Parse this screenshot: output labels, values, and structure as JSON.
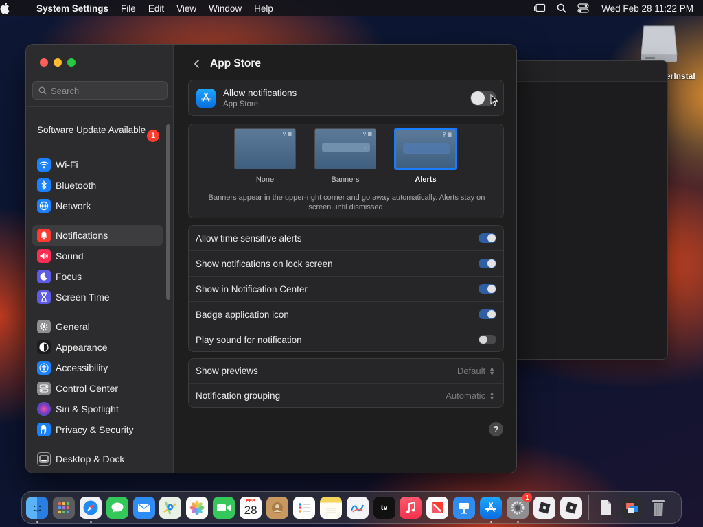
{
  "menubar": {
    "app_name": "System Settings",
    "menus": [
      "File",
      "Edit",
      "View",
      "Window",
      "Help"
    ],
    "clock": "Wed Feb 28  11:22 PM"
  },
  "desktop": {
    "drive_label": "erInstal"
  },
  "sidebar": {
    "search_placeholder": "Search",
    "software_update": {
      "label": "Software Update Available",
      "badge": "1"
    },
    "items": [
      {
        "label": "Wi-Fi",
        "icon": "wifi-icon",
        "color": "#1a82ff"
      },
      {
        "label": "Bluetooth",
        "icon": "bluetooth-icon",
        "color": "#1a82ff"
      },
      {
        "label": "Network",
        "icon": "globe-icon",
        "color": "#1a82ff"
      },
      {
        "label": "Notifications",
        "icon": "bell-icon",
        "color": "#ff3b30"
      },
      {
        "label": "Sound",
        "icon": "speaker-icon",
        "color": "#ff2d55"
      },
      {
        "label": "Focus",
        "icon": "moon-icon",
        "color": "#5e5ce6"
      },
      {
        "label": "Screen Time",
        "icon": "hourglass-icon",
        "color": "#5e5ce6"
      },
      {
        "label": "General",
        "icon": "gear-icon",
        "color": "#8e8e93"
      },
      {
        "label": "Appearance",
        "icon": "appearance-icon",
        "color": "#1c1c1e"
      },
      {
        "label": "Accessibility",
        "icon": "accessibility-icon",
        "color": "#1a82ff"
      },
      {
        "label": "Control Center",
        "icon": "control-center-icon",
        "color": "#8e8e93"
      },
      {
        "label": "Siri & Spotlight",
        "icon": "siri-icon",
        "color": "#6e3cbc"
      },
      {
        "label": "Privacy & Security",
        "icon": "hand-icon",
        "color": "#1a82ff"
      },
      {
        "label": "Desktop & Dock",
        "icon": "dock-icon",
        "color": "#2c2c2e"
      }
    ]
  },
  "content": {
    "title": "App Store",
    "allow": {
      "label": "Allow notifications",
      "sublabel": "App Store",
      "enabled": false
    },
    "styles": {
      "options": [
        {
          "label": "None"
        },
        {
          "label": "Banners"
        },
        {
          "label": "Alerts"
        }
      ],
      "selected": "Alerts",
      "description": "Banners appear in the upper-right corner and go away automatically. Alerts stay on screen until dismissed."
    },
    "switches": [
      {
        "label": "Allow time sensitive alerts",
        "on": true
      },
      {
        "label": "Show notifications on lock screen",
        "on": true
      },
      {
        "label": "Show in Notification Center",
        "on": true
      },
      {
        "label": "Badge application icon",
        "on": true
      },
      {
        "label": "Play sound for notification",
        "on": false
      }
    ],
    "selects": [
      {
        "label": "Show previews",
        "value": "Default"
      },
      {
        "label": "Notification grouping",
        "value": "Automatic"
      }
    ],
    "help": "?"
  },
  "dock": {
    "calendar_month": "FEB",
    "calendar_day": "28",
    "tv_label": "tv",
    "settings_badge": "1"
  }
}
